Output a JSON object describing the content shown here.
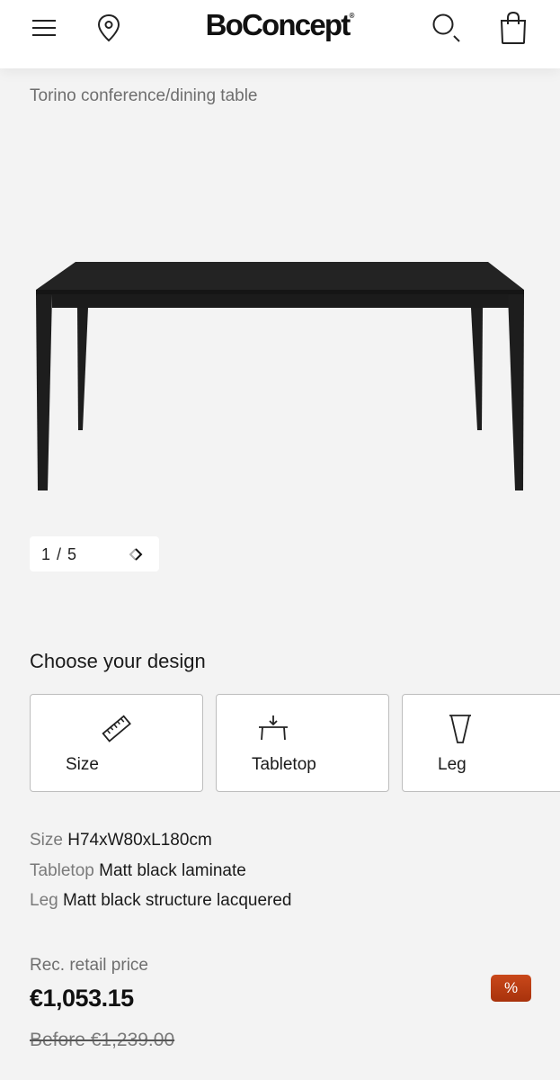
{
  "header": {
    "logo": "BoConcept",
    "logo_mark": "®",
    "icons": [
      "menu-icon",
      "location-pin-icon",
      "search-icon",
      "shopping-bag-icon"
    ]
  },
  "breadcrumb": "Torino conference/dining table",
  "gallery": {
    "counter": "1 / 5",
    "prev_icon": "chevron-left-icon",
    "next_icon": "chevron-right-icon"
  },
  "design": {
    "title": "Choose your design",
    "options": [
      {
        "label": "Size",
        "icon": "ruler-icon"
      },
      {
        "label": "Tabletop",
        "icon": "tabletop-icon"
      },
      {
        "label": "Leg",
        "icon": "leg-icon"
      }
    ]
  },
  "specs": [
    {
      "key": "Size",
      "value": "H74xW80xL180cm"
    },
    {
      "key": "Tabletop",
      "value": "Matt black laminate"
    },
    {
      "key": "Leg",
      "value": "Matt black structure lacquered"
    }
  ],
  "pricing": {
    "label": "Rec. retail price",
    "price": "€1,053.15",
    "before": "Before €1,239.00",
    "badge": "%"
  },
  "colors": {
    "accent_badge": "#b83d12",
    "background": "#f3f3f3",
    "table_black": "#1c1c1c"
  }
}
